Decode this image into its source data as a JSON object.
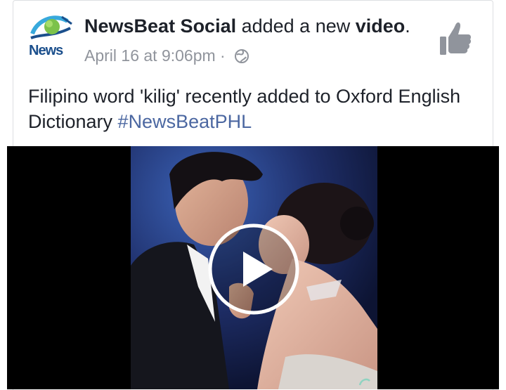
{
  "post": {
    "page_name": "NewsBeat Social",
    "action_text": " added a new ",
    "object_text": "video",
    "period": ".",
    "timestamp": "April 16 at 9:06pm",
    "separator": " · ",
    "privacy_icon": "globe-icon",
    "like_icon": "thumbs-up-icon",
    "text": "Filipino word 'kilig' recently added to Oxford English Dictionary ",
    "hashtag": "#NewsBeatPHL"
  },
  "avatar": {
    "logo_word": "News"
  },
  "video": {
    "play_icon": "play-icon"
  },
  "colors": {
    "text_primary": "#1d2129",
    "text_meta": "#90949c",
    "hashtag": "#4b67a1",
    "like_icon": "#90949c",
    "video_bg": "#000000"
  }
}
